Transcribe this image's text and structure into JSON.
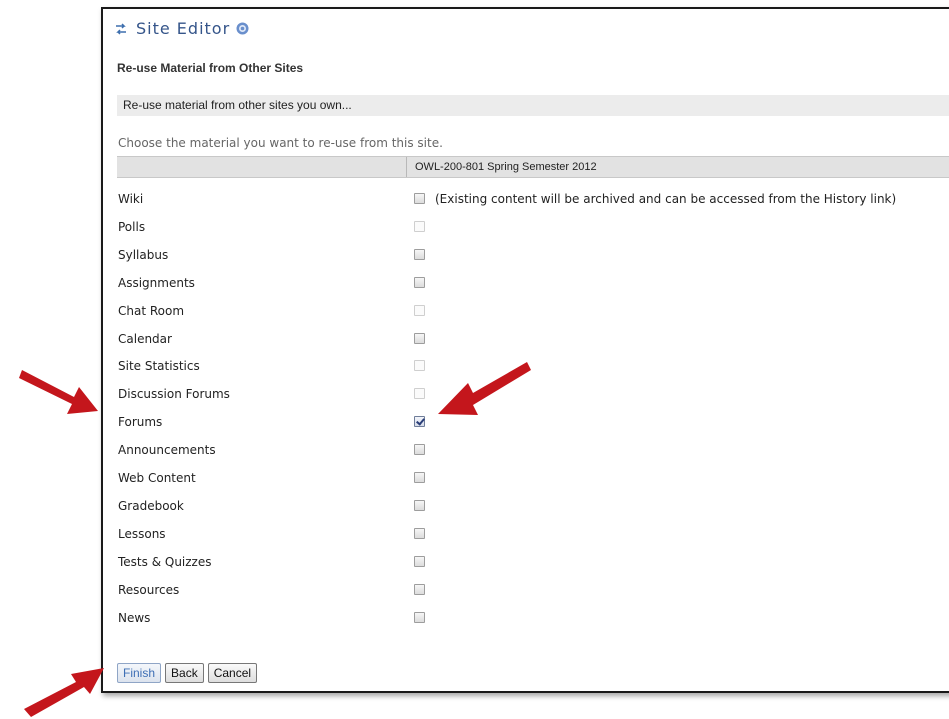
{
  "header": {
    "title": "Site Editor",
    "subtitle": "Re-use Material from Other Sites",
    "section_bar": "Re-use material from other sites you own...",
    "instructions": "Choose the material you want to re-use from this site.",
    "site_column": "OWL-200-801 Spring Semester 2012"
  },
  "tools": [
    {
      "label": "Wiki",
      "state": "unchecked",
      "note": "(Existing content will be archived and can be accessed from the History link)"
    },
    {
      "label": "Polls",
      "state": "disabled",
      "note": ""
    },
    {
      "label": "Syllabus",
      "state": "unchecked",
      "note": ""
    },
    {
      "label": "Assignments",
      "state": "unchecked",
      "note": ""
    },
    {
      "label": "Chat Room",
      "state": "disabled",
      "note": ""
    },
    {
      "label": "Calendar",
      "state": "unchecked",
      "note": ""
    },
    {
      "label": "Site Statistics",
      "state": "disabled",
      "note": ""
    },
    {
      "label": "Discussion Forums",
      "state": "disabled",
      "note": ""
    },
    {
      "label": "Forums",
      "state": "checked",
      "note": ""
    },
    {
      "label": "Announcements",
      "state": "unchecked",
      "note": ""
    },
    {
      "label": "Web Content",
      "state": "unchecked",
      "note": ""
    },
    {
      "label": "Gradebook",
      "state": "unchecked",
      "note": ""
    },
    {
      "label": "Lessons",
      "state": "unchecked",
      "note": ""
    },
    {
      "label": "Tests & Quizzes",
      "state": "unchecked",
      "note": ""
    },
    {
      "label": "Resources",
      "state": "unchecked",
      "note": ""
    },
    {
      "label": "News",
      "state": "unchecked",
      "note": ""
    }
  ],
  "buttons": {
    "finish": "Finish",
    "back": "Back",
    "cancel": "Cancel"
  },
  "colors": {
    "title": "#35558a",
    "arrow": "#c4161c",
    "finish_text": "#3e6fb5"
  },
  "icons": {
    "title": "swap-arrows-icon",
    "help": "help-icon"
  }
}
